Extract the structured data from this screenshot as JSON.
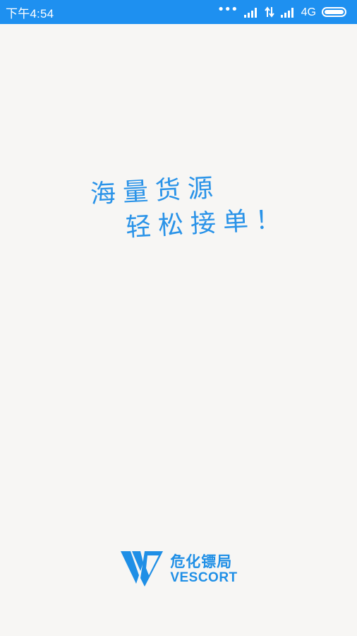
{
  "status_bar": {
    "time": "下午4:54",
    "dots": "•••",
    "network": "4G",
    "background_color": "#1e90f0",
    "icons": [
      "signal-icon",
      "data-transfer-icon",
      "signal-icon",
      "battery-icon"
    ]
  },
  "slogan": {
    "line1": "海量货源",
    "line2": "轻松接单！",
    "color": "#2a93e8"
  },
  "brand": {
    "name_cn": "危化镖局",
    "name_en": "VESCORT",
    "color": "#1f8fe6",
    "logo_icon": "vescort-logo-icon"
  }
}
